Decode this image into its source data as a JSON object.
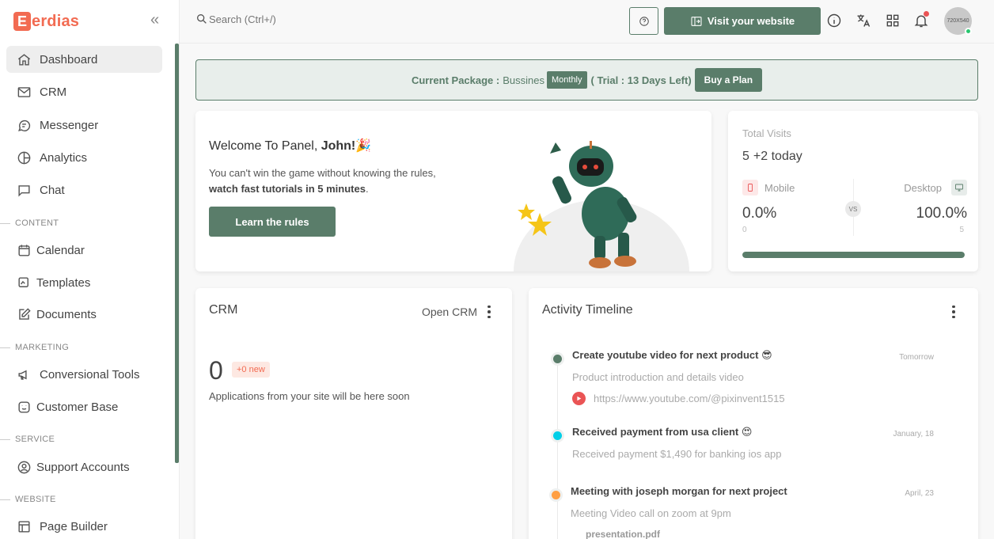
{
  "brand": {
    "mark": "E",
    "name": "erdias"
  },
  "sidebar": {
    "items": [
      {
        "label": "Dashboard"
      },
      {
        "label": "CRM"
      },
      {
        "label": "Messenger"
      },
      {
        "label": "Analytics"
      },
      {
        "label": "Chat"
      },
      {
        "label": "Calendar"
      },
      {
        "label": "Templates"
      },
      {
        "label": "Documents"
      },
      {
        "label": "Conversional Tools"
      },
      {
        "label": "Customer Base"
      },
      {
        "label": "Support Accounts"
      },
      {
        "label": "Page Builder"
      }
    ],
    "sections": {
      "content": "CONTENT",
      "marketing": "MARKETING",
      "service": "SERVICE",
      "website": "WEBSITE"
    }
  },
  "topbar": {
    "search_placeholder": "Search (Ctrl+/)",
    "visit_label": "Visit your website",
    "avatar_text": "720X540"
  },
  "package": {
    "label": "Current Package :",
    "name": "Bussines",
    "badge": "Monthly",
    "trial": "( Trial : 13 Days Left)",
    "buy": "Buy a Plan"
  },
  "welcome": {
    "title_prefix": "Welcome To Panel, ",
    "title_name": "John!",
    "title_emoji": "🎉",
    "text_prefix": "You can't win the game without knowing the rules, ",
    "text_bold": "watch fast tutorials in 5 minutes",
    "text_suffix": ".",
    "button": "Learn the rules"
  },
  "visits": {
    "label": "Total Visits",
    "value": "5",
    "today": "+2 today",
    "mobile_label": "Mobile",
    "desktop_label": "Desktop",
    "vs": "VS",
    "mobile_pct": "0.0%",
    "desktop_pct": "100.0%",
    "mobile_count": "0",
    "desktop_count": "5",
    "mobile_share": 0.0
  },
  "crm": {
    "title": "CRM",
    "open": "Open CRM",
    "count": "0",
    "new_badge": "+0 new",
    "subtitle": "Applications from your site will be here soon"
  },
  "activity": {
    "title": "Activity Timeline",
    "items": [
      {
        "title": "Create youtube video for next product 😎",
        "time": "Tomorrow",
        "desc": "Product introduction and details video",
        "link": "https://www.youtube.com/@pixinvent1515",
        "color": "#5a7d6a"
      },
      {
        "title": "Received payment from usa client 😍",
        "time": "January, 18",
        "desc": "Received payment $1,490 for banking ios app",
        "color": "#00cfe8"
      },
      {
        "title": "Meeting with joseph morgan for next project",
        "time": "April, 23",
        "desc": "Meeting Video call on zoom at 9pm",
        "file": "presentation.pdf",
        "color": "#ff9f43"
      }
    ]
  },
  "colors": {
    "accent": "#5a7d6a",
    "brand": "#f26b52",
    "danger": "#ea5455"
  }
}
